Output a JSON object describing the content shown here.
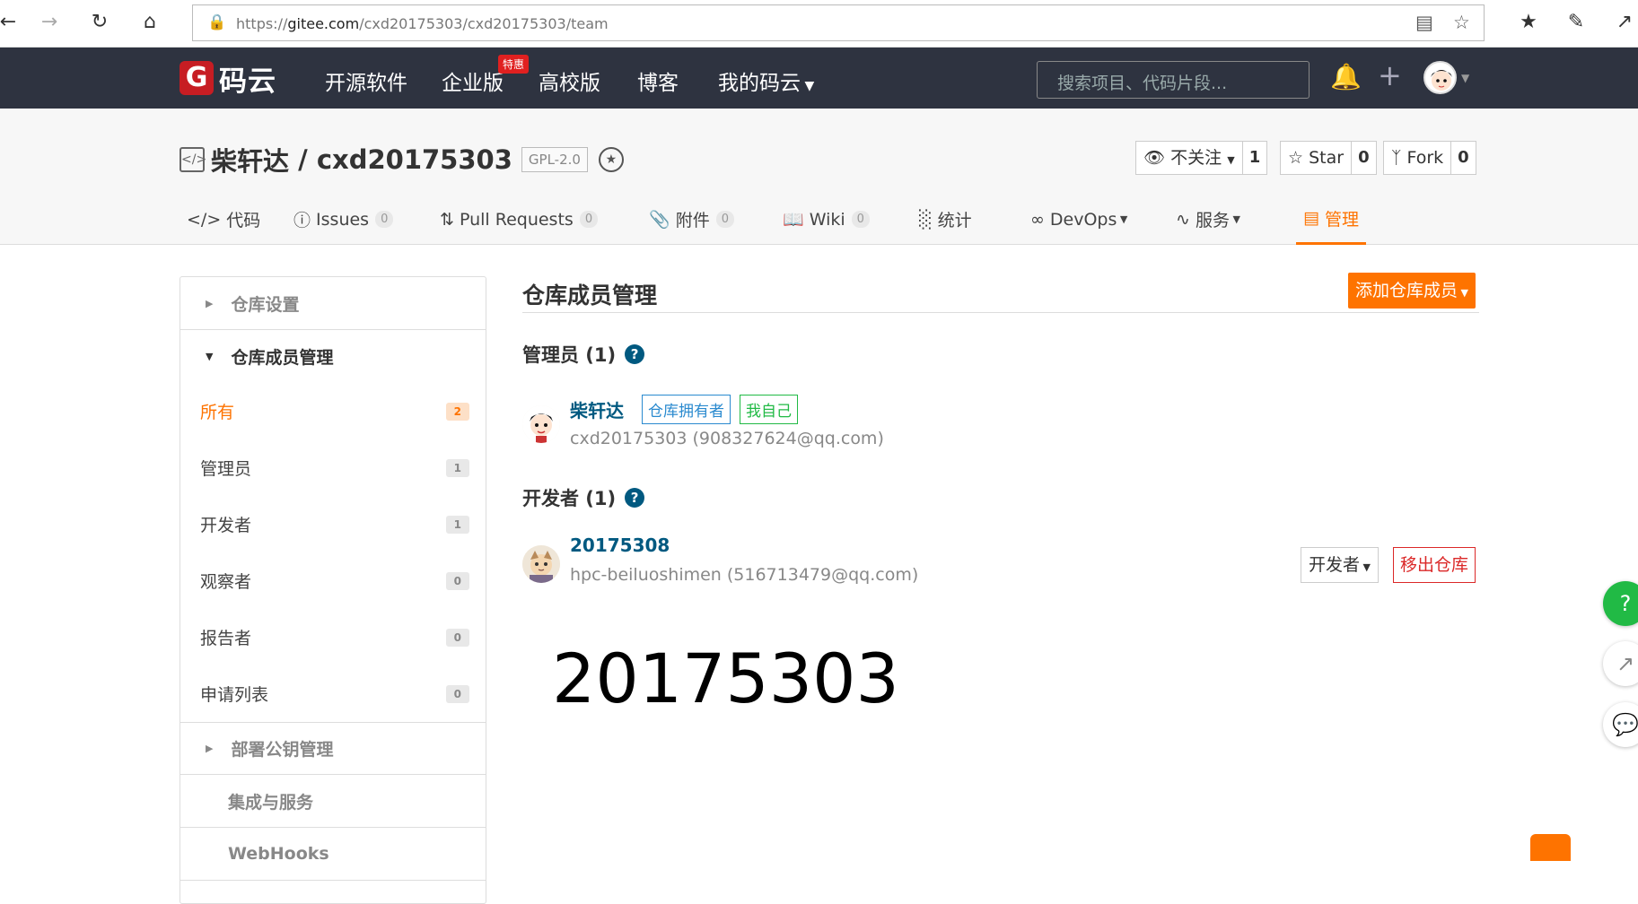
{
  "browser": {
    "url_prefix": "https://",
    "url_host": "gitee.com",
    "url_path": "/cxd20175303/cxd20175303/team"
  },
  "topnav": {
    "logo_text": "码云",
    "items": [
      "开源软件",
      "企业版",
      "高校版",
      "博客",
      "我的码云"
    ],
    "hot_badge": "特惠",
    "search_placeholder": "搜索项目、代码片段..."
  },
  "repo": {
    "owner": "柴轩达",
    "name": "cxd20175303",
    "license": "GPL-2.0",
    "watch_label": "不关注",
    "watch_count": "1",
    "star_label": "Star",
    "star_count": "0",
    "fork_label": "Fork",
    "fork_count": "0"
  },
  "tabs": [
    {
      "label": "代码",
      "count": null
    },
    {
      "label": "Issues",
      "count": "0"
    },
    {
      "label": "Pull Requests",
      "count": "0"
    },
    {
      "label": "附件",
      "count": "0"
    },
    {
      "label": "Wiki",
      "count": "0"
    },
    {
      "label": "统计",
      "count": null
    },
    {
      "label": "DevOps",
      "count": null
    },
    {
      "label": "服务",
      "count": null
    },
    {
      "label": "管理",
      "count": null
    }
  ],
  "sidebar": {
    "repo_settings": "仓库设置",
    "member_mgmt": "仓库成员管理",
    "items": [
      {
        "label": "所有",
        "count": "2"
      },
      {
        "label": "管理员",
        "count": "1"
      },
      {
        "label": "开发者",
        "count": "1"
      },
      {
        "label": "观察者",
        "count": "0"
      },
      {
        "label": "报告者",
        "count": "0"
      },
      {
        "label": "申请列表",
        "count": "0"
      }
    ],
    "deploy_keys": "部署公钥管理",
    "integrations": "集成与服务",
    "webhooks": "WebHooks"
  },
  "main": {
    "title": "仓库成员管理",
    "add_button": "添加仓库成员",
    "admin_section": "管理员 (1)",
    "admin": {
      "name": "柴轩达",
      "tag_owner": "仓库拥有者",
      "tag_self": "我自己",
      "sub": "cxd20175303 (908327624@qq.com)"
    },
    "dev_section": "开发者 (1)",
    "developer": {
      "name": "20175308",
      "sub": "hpc-beiluoshimen (516713479@qq.com)",
      "role": "开发者",
      "remove": "移出仓库"
    },
    "big_number": "20175303"
  }
}
